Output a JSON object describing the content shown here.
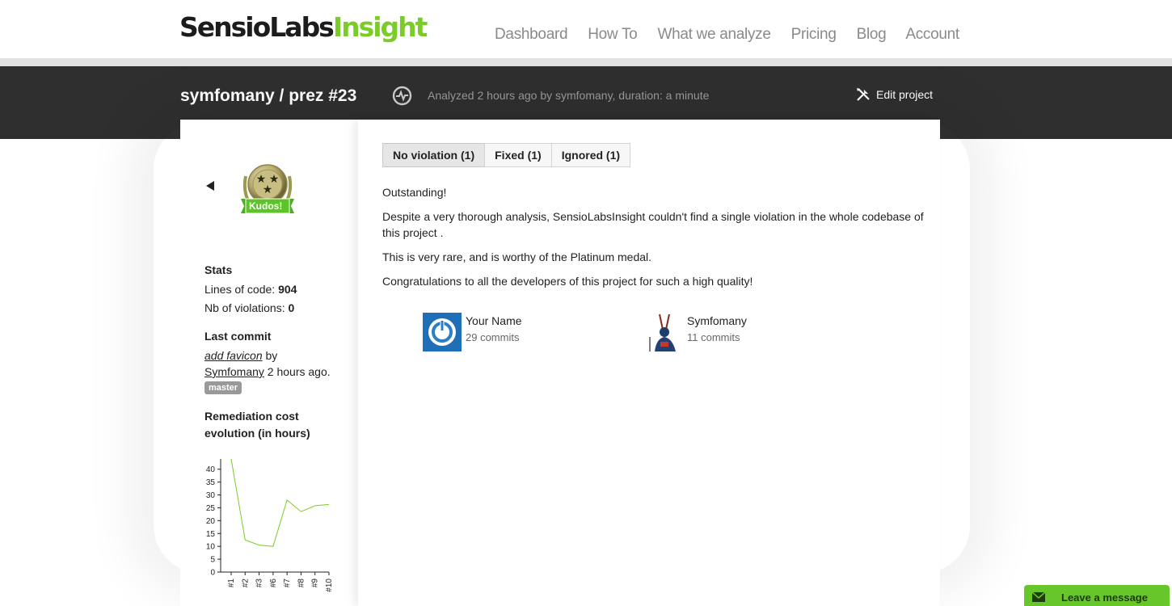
{
  "header": {
    "logo_main": "SensioLabs",
    "logo_accent": "Insight",
    "nav": [
      "Dashboard",
      "How To",
      "What we analyze",
      "Pricing",
      "Blog",
      "Account"
    ]
  },
  "project": {
    "title": "symfomany / prez #23",
    "analyzed": "Analyzed 2 hours ago by symfomany, duration: a minute",
    "edit_label": "Edit project"
  },
  "sidebar": {
    "medal_label": "Kudos!",
    "stats_heading": "Stats",
    "loc_label": "Lines of code: ",
    "loc_value": "904",
    "violations_label": "Nb of violations: ",
    "violations_value": "0",
    "last_commit_heading": "Last commit",
    "commit_message": "add favicon",
    "commit_by": " by",
    "commit_author": "Symfomany",
    "commit_time": " 2 hours ago.",
    "branch": "master",
    "remediation_heading_1": "Remediation cost",
    "remediation_heading_2": "evolution (in hours)"
  },
  "tabs": [
    "No violation (1)",
    "Fixed (1)",
    "Ignored (1)"
  ],
  "content": {
    "p1": "Outstanding!",
    "p2": "Despite a very thorough analysis, SensioLabsInsight couldn't find a single violation in the whole codebase of this project .",
    "p3": "This is very rare, and is worthy of the Platinum medal.",
    "p4": "Congratulations to all the developers of this project for such a high quality!"
  },
  "contributors": [
    {
      "name": "Your Name",
      "commits": "29 commits"
    },
    {
      "name": "Symfomany",
      "commits": "11 commits"
    }
  ],
  "chat": {
    "label": "Leave a message"
  },
  "colors": {
    "accent": "#7ccc29",
    "dark_band": "#2f2f2f",
    "chart_line": "#7ccc29"
  },
  "chart_data": {
    "type": "line",
    "categories": [
      "#1",
      "#2",
      "#3",
      "#6",
      "#7",
      "#8",
      "#9",
      "#10"
    ],
    "series": [
      {
        "values": [
          44,
          12.5,
          10.5,
          10,
          28,
          23.5,
          25.8,
          26.3
        ]
      }
    ],
    "yticks": [
      0,
      5,
      10,
      15,
      20,
      25,
      30,
      35,
      40
    ],
    "ylim": [
      0,
      44
    ]
  }
}
